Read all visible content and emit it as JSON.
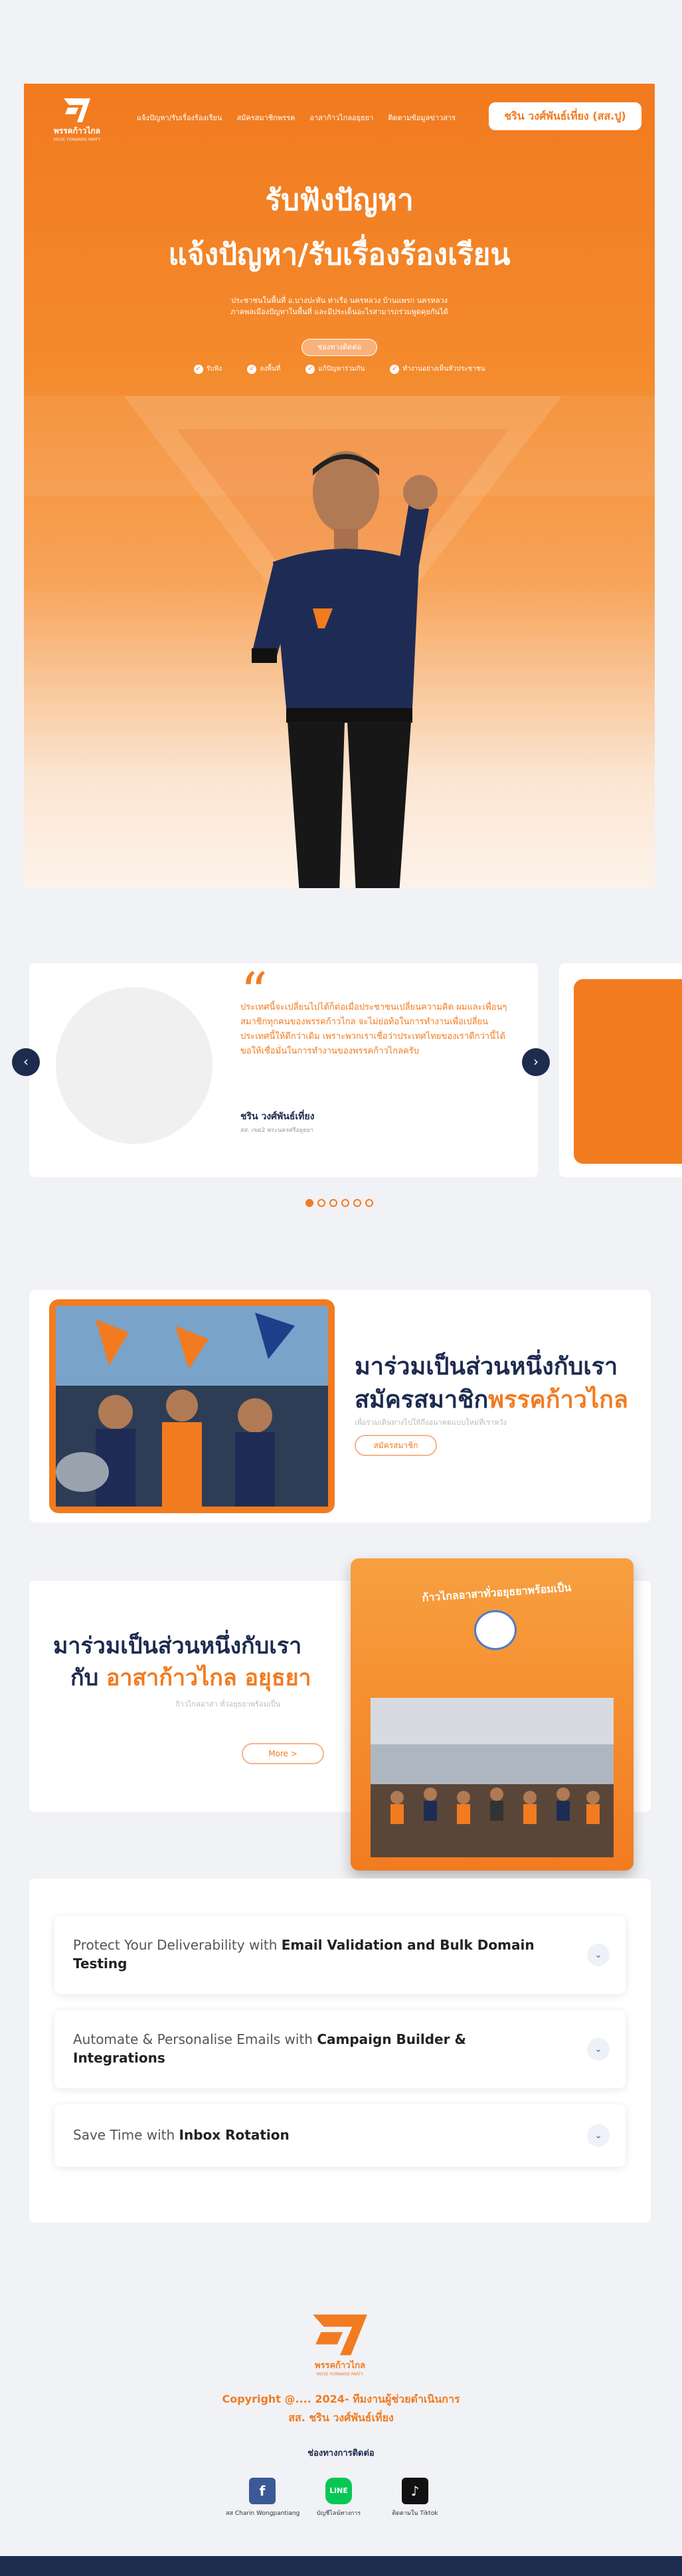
{
  "nav": {
    "logo_name": "พรรคก้าวไกล",
    "logo_sub": "MOVE FORWARD PARTY",
    "links": [
      "แจ้งปัญหา/รับเรื่องร้องเรียน",
      "สมัครสมาชิกพรรค",
      "อาสาก้าวไกลอยุธยา",
      "ติดตามข้อมูลข่าวสาร"
    ],
    "profile_button": "ชริน วงศ์พันธ์เที่ยง (สส.ปู)"
  },
  "hero": {
    "title_line1": "รับฟังปัญหา",
    "title_line2": "แจ้งปัญหา/รับเรื่องร้องเรียน",
    "description": "ประชาชนในพื้นที่ อ.บางปะหัน ท่าเรือ นครหลวง บ้านแพรก นครหลวง ภาคพลเมืองปัญหาในพื้นที่ และมีประเด็นอะไรสามารถร่วมพูดคุยกันได้",
    "cta": "ช่องทางติดต่อ",
    "checks": [
      "รับฟัง",
      "ลงพื้นที่",
      "แก้ปัญหาร่วมกัน",
      "ทำงานอย่างเห็นหัวประชาชน"
    ]
  },
  "testimonial": {
    "quote": "ประเทศนี้จะเปลี่ยนไปได้ก็ต่อเมื่อประชาชนเปลี่ยนความคิด ผมและเพื่อนๆ สมาชิกทุกคนของพรรคก้าวไกล จะไม่ย่อท้อในการทำงานเพื่อเปลี่ยนประเทศนี้ให้ดีกว่าเดิม เพราะพวกเราเชื่อว่าประเทศไทยของเราดีกว่านี้ได้ ขอให้เชื่อมั่นในการทำงานของพรรคก้าวไกลครับ",
    "name": "ชริน วงศ์พันธ์เที่ยง",
    "role": "สส. เขต2 พระนครศรีอยุธยา",
    "dots_total": 6,
    "dots_active": 0
  },
  "join_member": {
    "title_line1": "มาร่วมเป็นส่วนหนึ่งกับเรา",
    "title_line2_prefix": "สมัครสมาชิก",
    "title_line2_highlight": "พรรคก้าวไกล",
    "subtitle": "เพื่อร่วมเดินทางไปให้ถึงอนาคตแบบใหม่ที่เราหวัง",
    "button": "สมัครสมาชิก"
  },
  "join_volunteer": {
    "title_line1": "มาร่วมเป็นส่วนหนึ่งกับเรา",
    "title_line2_prefix": "กับ ",
    "title_line2_highlight": "อาสาก้าวไกล อยุธยา",
    "subtitle": "ก้าวไกลอาสา ทั่วอยุธยาพร้อมเป็น",
    "button": "More >",
    "card_text": "ก้าวไกลอาสาทั่วอยุธยาพร้อมเป็น"
  },
  "faq": [
    {
      "prefix": "Protect Your Deliverability with ",
      "bold": "Email Validation and Bulk Domain Testing"
    },
    {
      "prefix": "Automate & Personalise Emails with ",
      "bold": "Campaign Builder & Integrations"
    },
    {
      "prefix": "Save Time with ",
      "bold": "Inbox Rotation"
    }
  ],
  "footer": {
    "logo_name": "พรรคก้าวไกล",
    "logo_sub": "MOVE FORWARD PARTY",
    "copyright": "Copyright @.... 2024- ทีมงานผู้ช่วยดำเนินการ",
    "mp": "สส. ชริน วงศ์พันธ์เที่ยง",
    "contact_title": "ช่องทางการติดต่อ",
    "socials": [
      {
        "icon": "facebook-icon",
        "label": "สส Charin Wongpantiang",
        "color": "#3b5998"
      },
      {
        "icon": "line-icon",
        "label": "บัญชีไลน์ทางการ",
        "color": "#06c755"
      },
      {
        "icon": "tiktok-icon",
        "label": "ติดตามใน Tiktok",
        "color": "#111111"
      }
    ]
  },
  "colors": {
    "accent": "#f27b20",
    "navy": "#1d2b4f"
  }
}
